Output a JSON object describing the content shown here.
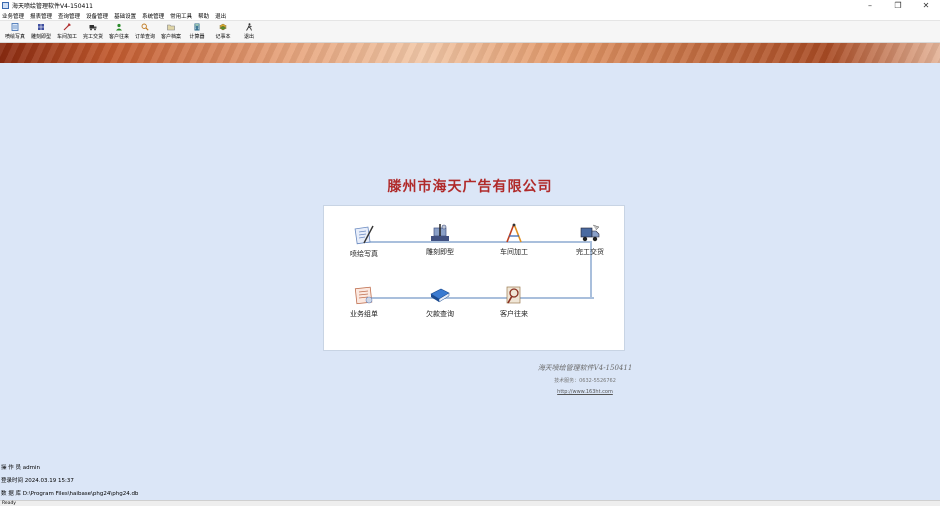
{
  "window": {
    "title": "海天喷绘管理软件V4-150411",
    "controls": [
      "–",
      "❐",
      "✕"
    ]
  },
  "menu": [
    "业务管理",
    "报表管理",
    "查询管理",
    "设备管理",
    "基础设置",
    "系统管理",
    "常用工具",
    "帮助",
    "退出"
  ],
  "toolbar": [
    {
      "label": "喷绘写真",
      "icon": "document-icon",
      "color": "#3a6ab0"
    },
    {
      "label": "雕刻即型",
      "icon": "grid-icon",
      "color": "#4050a0"
    },
    {
      "label": "车间加工",
      "icon": "tool-icon",
      "color": "#b03030"
    },
    {
      "label": "完工交货",
      "icon": "truck-icon",
      "color": "#303030"
    },
    {
      "label": "客户往来",
      "icon": "people-icon",
      "color": "#2a8a2a"
    },
    {
      "label": "订单查询",
      "icon": "search-icon",
      "color": "#c07a20"
    },
    {
      "label": "客户档案",
      "icon": "folder-icon",
      "color": "#808080"
    },
    {
      "label": "计算器",
      "icon": "calculator-icon",
      "color": "#2a6a8a"
    },
    {
      "label": "记事本",
      "icon": "notebook-icon",
      "color": "#8a6a20"
    },
    {
      "label": "退出",
      "icon": "exit-icon",
      "color": "#303030"
    }
  ],
  "main": {
    "company_name": "滕州市海天广告有限公司",
    "nodes_row1": [
      "喷绘写真",
      "雕刻即型",
      "车间加工",
      "完工交货"
    ],
    "nodes_row2": [
      "业务组单",
      "欠款查询",
      "客户往来"
    ],
    "product": "海天喷绘管理软件V4-150411",
    "tel": "技术服务：0632-5526762",
    "url": "http://www.163ht.com"
  },
  "status": {
    "operator": "操 作 员 admin",
    "login_time": "登录时间 2024.03.19 15:37",
    "database": "数 据 库 D:\\Program Files\\haibase\\phg24\\phg24.db",
    "bar": "Ready"
  }
}
